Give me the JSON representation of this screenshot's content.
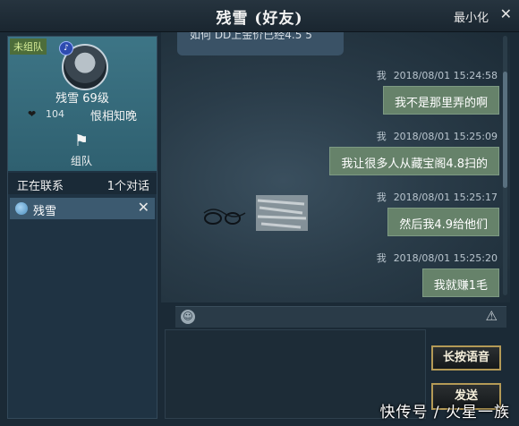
{
  "window": {
    "title": "残雪 (好友)",
    "minimize_label": "最小化",
    "close_icon": "close-x-icon"
  },
  "profile": {
    "team_status": "未组队",
    "name_level": "残雪  69级",
    "intimacy": "104",
    "relation": "恨相知晚",
    "team_button_label": "组队"
  },
  "contacts": {
    "header_label": "正在联系",
    "count_label": "1个对话",
    "items": [
      {
        "name": "残雪"
      }
    ]
  },
  "chat": {
    "partial_message": "如何 DD上金价已经4.5 5",
    "messages": [
      {
        "sender": "我",
        "timestamp": "2018/08/01  15:24:58",
        "text": "我不是那里弄的啊"
      },
      {
        "sender": "我",
        "timestamp": "2018/08/01  15:25:09",
        "text": "我让很多人从藏宝阁4.8扫的"
      },
      {
        "sender": "我",
        "timestamp": "2018/08/01  15:25:17",
        "text": "然后我4.9给他们"
      },
      {
        "sender": "我",
        "timestamp": "2018/08/01  15:25:20",
        "text": "我就赚1毛"
      }
    ]
  },
  "input": {
    "voice_button": "长按语音",
    "send_button": "发送"
  },
  "watermark": "快传号 / 火星一族",
  "colors": {
    "bubble": "#66826a",
    "button_border": "#b49a56",
    "profile_bg": "#3d7586"
  }
}
